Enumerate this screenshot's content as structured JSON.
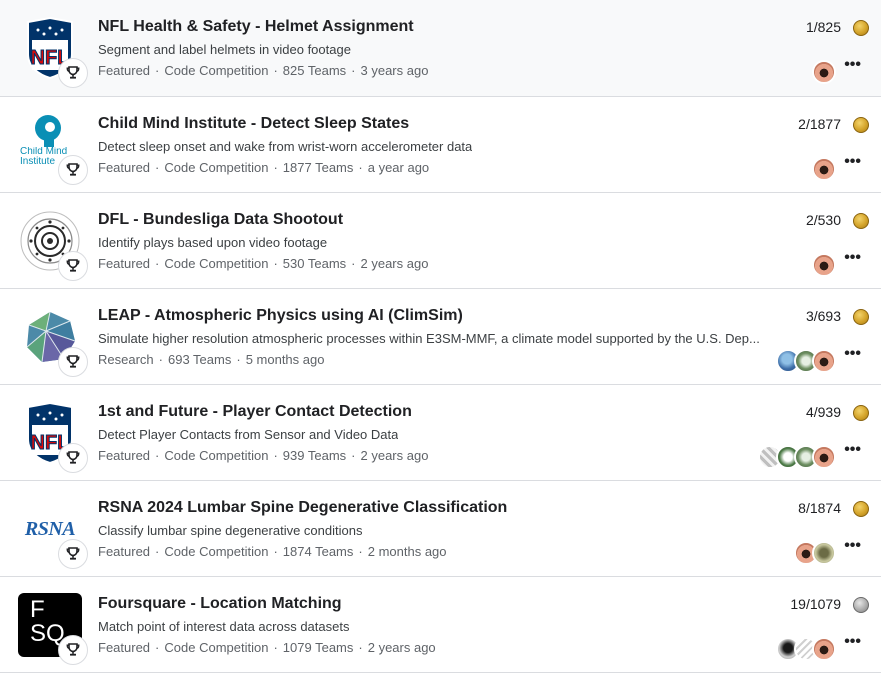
{
  "competitions": [
    {
      "title": "NFL Health & Safety - Helmet Assignment",
      "description": "Segment and label helmets in video footage",
      "category": "Featured",
      "type": "Code Competition",
      "teams": "825 Teams",
      "age": "3 years ago",
      "rank": "1/825",
      "medal": "gold",
      "logo": "nfl-logo",
      "avatars": [
        "a1"
      ]
    },
    {
      "title": "Child Mind Institute - Detect Sleep States",
      "description": "Detect sleep onset and wake from wrist-worn accelerometer data",
      "category": "Featured",
      "type": "Code Competition",
      "teams": "1877 Teams",
      "age": "a year ago",
      "rank": "2/1877",
      "medal": "gold",
      "logo": "child-mind-logo",
      "logo_text": "Child Mind Institute",
      "avatars": [
        "a1"
      ]
    },
    {
      "title": "DFL - Bundesliga Data Shootout",
      "description": "Identify plays based upon video footage",
      "category": "Featured",
      "type": "Code Competition",
      "teams": "530 Teams",
      "age": "2 years ago",
      "rank": "2/530",
      "medal": "gold",
      "logo": "dfl-logo",
      "avatars": [
        "a1"
      ]
    },
    {
      "title": "LEAP - Atmospheric Physics using AI (ClimSim)",
      "description": "Simulate higher resolution atmospheric processes within E3SM-MMF, a climate model supported by the U.S. Dep...",
      "category": "Research",
      "type": "",
      "teams": "693 Teams",
      "age": "5 months ago",
      "rank": "3/693",
      "medal": "gold",
      "logo": "leap-logo",
      "avatars": [
        "a1",
        "a3",
        "a2"
      ]
    },
    {
      "title": "1st and Future - Player Contact Detection",
      "description": "Detect Player Contacts from Sensor and Video Data",
      "category": "Featured",
      "type": "Code Competition",
      "teams": "939 Teams",
      "age": "2 years ago",
      "rank": "4/939",
      "medal": "gold",
      "logo": "nfl-logo",
      "avatars": [
        "a1",
        "a3",
        "a4",
        "a5"
      ]
    },
    {
      "title": "RSNA 2024 Lumbar Spine Degenerative Classification",
      "description": "Classify lumbar spine degenerative conditions",
      "category": "Featured",
      "type": "Code Competition",
      "teams": "1874 Teams",
      "age": "2 months ago",
      "rank": "8/1874",
      "medal": "gold",
      "logo": "rsna-logo",
      "logo_text": "RSNA",
      "avatars": [
        "a6",
        "a1"
      ]
    },
    {
      "title": "Foursquare - Location Matching",
      "description": "Match point of interest data across datasets",
      "category": "Featured",
      "type": "Code Competition",
      "teams": "1079 Teams",
      "age": "2 years ago",
      "rank": "19/1079",
      "medal": "silver",
      "logo": "foursquare-logo",
      "logo_text": "FSQ",
      "avatars": [
        "a1",
        "a8",
        "a7"
      ]
    }
  ],
  "colors": {
    "gold_medal": "#d4a42b",
    "silver_medal": "#a8a8a8",
    "divider": "#dadce0",
    "nfl_blue": "#013369",
    "nfl_red": "#d50a0a",
    "rsna_blue": "#1f5fa8",
    "child_mind_teal": "#0a8fb5"
  },
  "icons": {
    "badge": "trophy-icon",
    "menu": "more-options-icon"
  },
  "menu_glyph": "•••"
}
